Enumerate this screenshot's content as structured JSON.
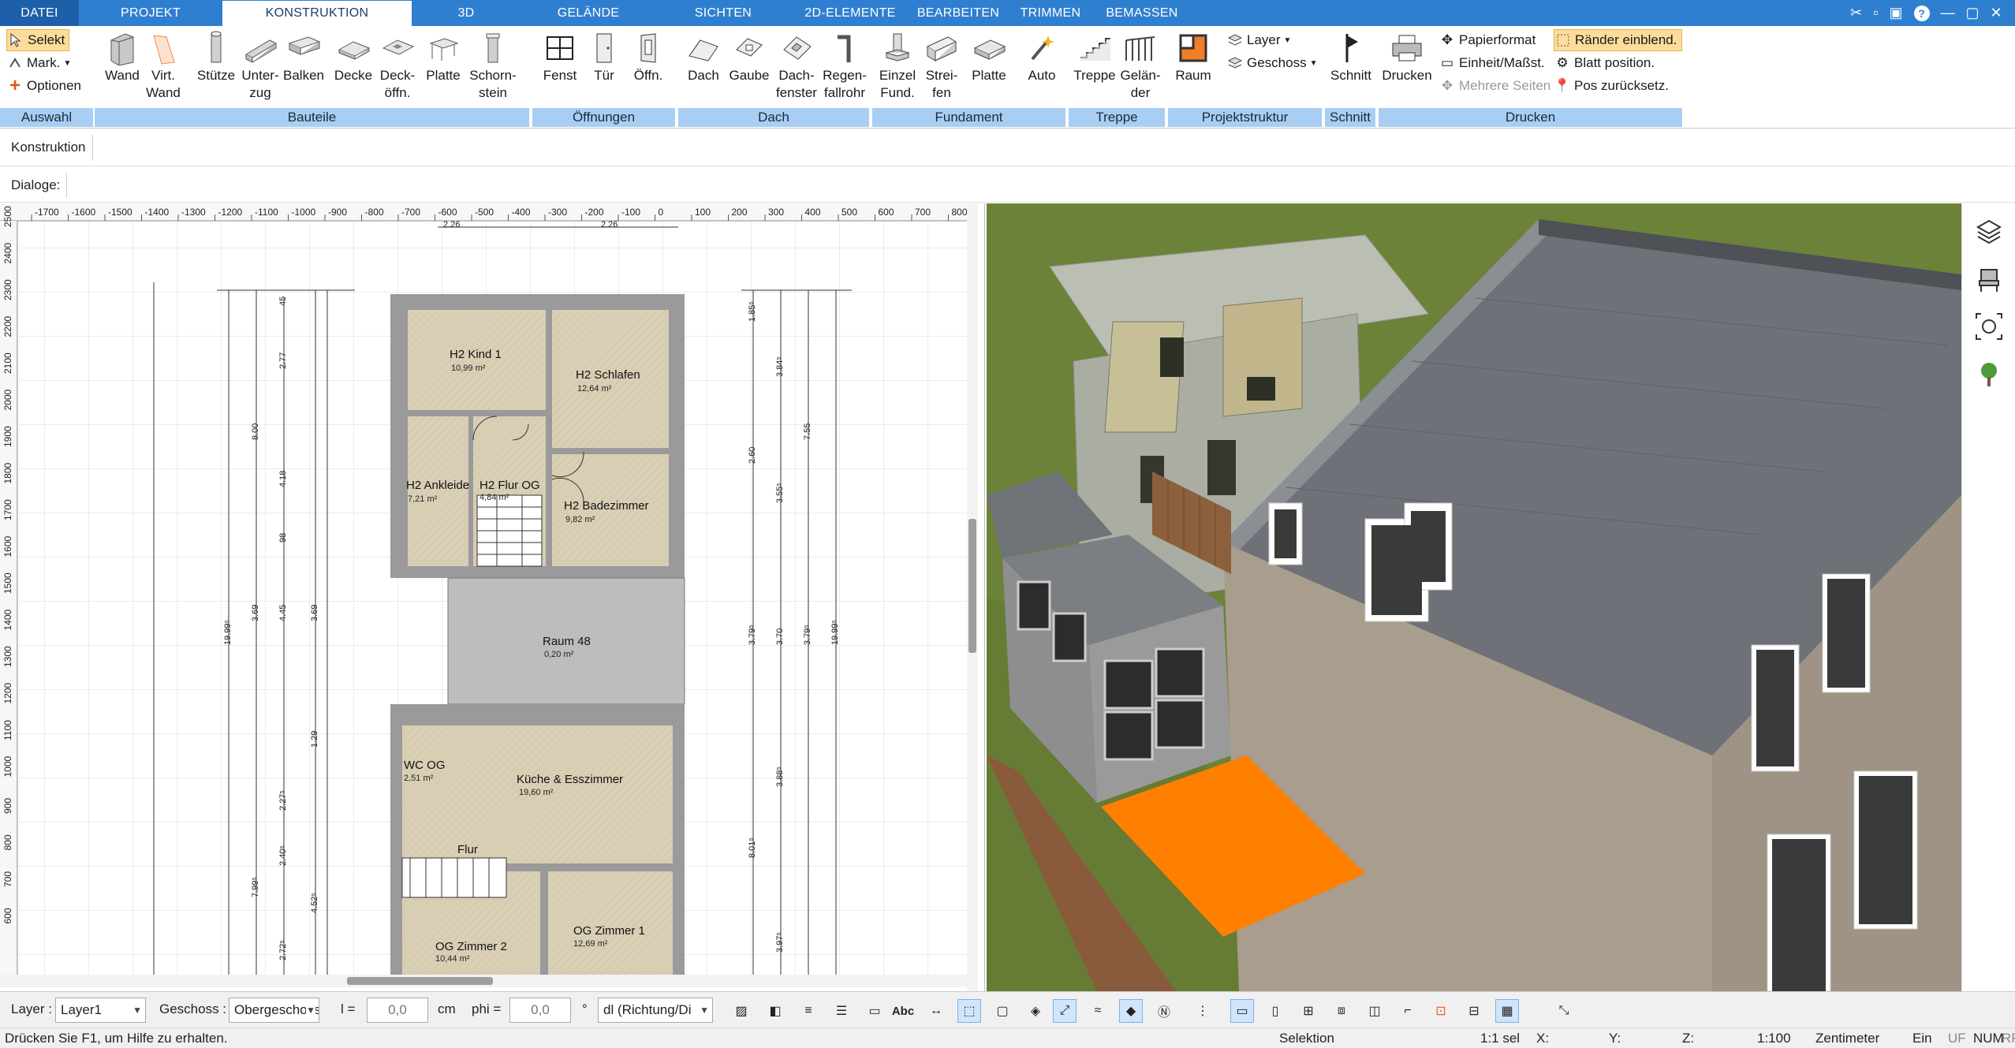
{
  "tabs": [
    "DATEI",
    "PROJEKT",
    "KONSTRUKTION",
    "3D",
    "GELÄNDE",
    "SICHTEN",
    "2D-ELEMENTE",
    "BEARBEITEN",
    "TRIMMEN",
    "BEMASSEN"
  ],
  "active_tab": "KONSTRUKTION",
  "ribbon": {
    "auswahl": {
      "label": "Auswahl",
      "selekt": "Selekt",
      "mark": "Mark.",
      "optionen": "Optionen"
    },
    "bauteile": {
      "label": "Bauteile",
      "wand": "Wand",
      "virt_l1": "Virt.",
      "virt_l2": "Wand",
      "stuetze": "Stütze",
      "unterzug_l1": "Unter-",
      "unterzug_l2": "zug",
      "balken": "Balken",
      "decke": "Decke",
      "deckoeffn_l1": "Deck-",
      "deckoeffn_l2": "öffn.",
      "platte": "Platte",
      "schorn_l1": "Schorn-",
      "schorn_l2": "stein"
    },
    "oeffnungen": {
      "label": "Öffnungen",
      "fenst": "Fenst",
      "tuer": "Tür",
      "oeffn": "Öffn."
    },
    "dach": {
      "label": "Dach",
      "dach": "Dach",
      "gaube": "Gaube",
      "dachfenster_l1": "Dach-",
      "dachfenster_l2": "fenster",
      "regen_l1": "Regen-",
      "regen_l2": "fallrohr"
    },
    "fundament": {
      "label": "Fundament",
      "einzel_l1": "Einzel",
      "einzel_l2": "Fund.",
      "streifen_l1": "Strei-",
      "streifen_l2": "fen",
      "platte": "Platte",
      "auto": "Auto"
    },
    "treppe": {
      "label": "Treppe",
      "treppe": "Treppe",
      "gelaender_l1": "Gelän-",
      "gelaender_l2": "der"
    },
    "projektstruktur": {
      "label": "Projektstruktur",
      "raum": "Raum",
      "layer": "Layer",
      "geschoss": "Geschoss"
    },
    "schnitt": {
      "label": "Schnitt",
      "schnitt": "Schnitt"
    },
    "drucken": {
      "label": "Drucken",
      "drucken": "Drucken",
      "papierformat": "Papierformat",
      "einheit": "Einheit/Maßst.",
      "mehrere": "Mehrere Seiten",
      "raender": "Ränder einblend.",
      "blatt": "Blatt position.",
      "pos": "Pos zurücksetz."
    }
  },
  "subbar": {
    "konstruktion": "Konstruktion",
    "dialoge": "Dialoge:"
  },
  "plan": {
    "ruler_ticks": [
      "-1700",
      "-1600",
      "-1500",
      "-1400",
      "-1300",
      "-1200",
      "-1100",
      "-1000",
      "-900",
      "-800",
      "-700",
      "-600",
      "-500",
      "-400",
      "-300",
      "-200",
      "-100",
      "0",
      "100",
      "200",
      "300",
      "400",
      "500",
      "600",
      "700",
      "800"
    ],
    "vruler_ticks": [
      "2500",
      "2400",
      "2300",
      "2200",
      "2100",
      "2000",
      "1900",
      "1800",
      "1700",
      "1600",
      "1500",
      "1400",
      "1300",
      "1200",
      "1100",
      "1000",
      "900",
      "800",
      "700",
      "600"
    ],
    "rooms": [
      {
        "name": "H2 Kind 1",
        "area": "10,99 m²"
      },
      {
        "name": "H2 Schlafen",
        "area": "12,64 m²"
      },
      {
        "name": "H2 Ankleide",
        "area": "7,21 m²"
      },
      {
        "name": "H2 Flur OG",
        "area": "4,84 m²"
      },
      {
        "name": "H2 Badezimmer",
        "area": "9,82 m²"
      },
      {
        "name": "Raum 48",
        "area": "0,20 m²"
      },
      {
        "name": "WC OG",
        "area": "2,51 m²"
      },
      {
        "name": "Küche & Esszimmer",
        "area": "19,60 m²"
      },
      {
        "name": "Flur",
        "area": ""
      },
      {
        "name": "OG Zimmer 2",
        "area": "10,44 m²"
      },
      {
        "name": "OG Zimmer 1",
        "area": "12,69 m²"
      }
    ],
    "dims_top": [
      "2.26",
      "2.26"
    ],
    "dims_left": [
      "45",
      "2.77",
      "8.00",
      "4.18",
      "98",
      "3.69",
      "4.45",
      "3.69",
      "1.29",
      "2.27⁵",
      "7.99⁵",
      "2.40⁵",
      "4.52⁵",
      "2.72⁵",
      "19.99⁵"
    ],
    "dims_right": [
      "1.85⁵",
      "3.84⁵",
      "7.55",
      "2.60",
      "3.55⁵",
      "3.79⁵",
      "3.70",
      "3.79⁵",
      "19.99⁵",
      "3.88⁵",
      "8.01⁵",
      "3.97⁵"
    ]
  },
  "bottom": {
    "layer_label": "Layer :",
    "layer_value": "Layer1",
    "geschoss_label": "Geschoss :",
    "geschoss_value": "Obergeschoss",
    "l_label": "l =",
    "l_value": "0,0",
    "l_unit": "cm",
    "phi_label": "phi =",
    "phi_value": "0,0",
    "phi_unit": "°",
    "dl_value": "dl (Richtung/Di"
  },
  "status": {
    "help": "Drücken Sie F1, um Hilfe zu erhalten.",
    "mode": "Selektion",
    "sel": "1:1 sel",
    "x": "X:",
    "y": "Y:",
    "z": "Z:",
    "scale": "1:100",
    "unit": "Zentimeter",
    "ein": "Ein",
    "uf": "UF",
    "num": "NUM",
    "rf": "RF"
  },
  "colors": {
    "accent": "#2f7fd1",
    "ribbon_group": "#a8cff3",
    "floor": "#d9cfb5",
    "wall": "#9a9a9a",
    "highlight": "#ff7f00"
  }
}
